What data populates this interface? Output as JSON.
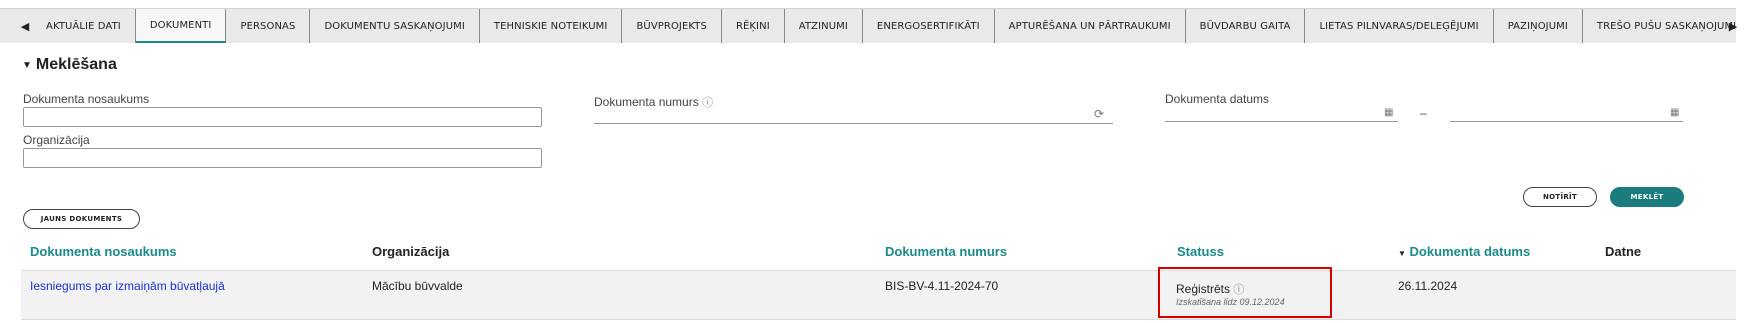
{
  "tabs": [
    "AKTUĀLIE DATI",
    "DOKUMENTI",
    "PERSONAS",
    "DOKUMENTU SASKAŅOJUMI",
    "TEHNISKIE NOTEIKUMI",
    "BŪVPROJEKTS",
    "RĒĶINI",
    "ATZINUMI",
    "ENERGOSERTIFIKĀTI",
    "APTURĒŠANA UN PĀRTRAUKUMI",
    "BŪVDARBU GAITA",
    "LIETAS PILNVARAS/DELEĢĒJUMI",
    "PAZIŅOJUMI",
    "TREŠO PUŠU SASKAŅOJUMI"
  ],
  "active_tab": "DOKUMENTI",
  "search": {
    "title": "Meklēšana",
    "doc_name_label": "Dokumenta nosaukums",
    "org_label": "Organizācija",
    "doc_number_label": "Dokumenta numurs",
    "doc_date_label": "Dokumenta datums",
    "date_separator": "–",
    "clear_button": "NOTĪRĪT",
    "search_button": "MEKLĒT"
  },
  "new_doc_button": "JAUNS DOKUMENTS",
  "table": {
    "headers": {
      "name": "Dokumenta nosaukums",
      "org": "Organizācija",
      "number": "Dokumenta numurs",
      "status": "Statuss",
      "date": "Dokumenta datums",
      "file": "Datne"
    },
    "rows": [
      {
        "name": "Iesniegums par izmaiņām būvatļaujā",
        "org": "Mācību būvvalde",
        "number": "BIS-BV-4.11-2024-70",
        "status": "Reģistrēts",
        "status_note": "Izskatīšana līdz 09.12.2024",
        "date": "26.11.2024"
      }
    ]
  },
  "colors": {
    "accent": "#1a8a8a",
    "link": "#1a2fd6",
    "highlight": "#d40000"
  },
  "icons": [
    "chevron-left-icon",
    "chevron-right-icon",
    "caret-down-icon",
    "info-icon",
    "refresh-icon",
    "calendar-icon",
    "sort-down-icon"
  ]
}
